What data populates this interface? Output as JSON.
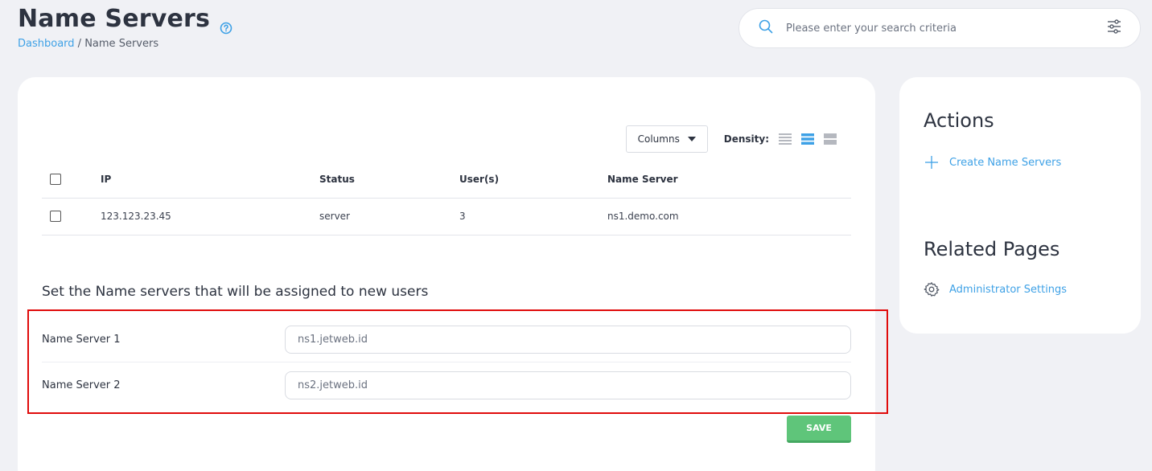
{
  "header": {
    "title": "Name Servers",
    "breadcrumb_root": "Dashboard",
    "breadcrumb_sep": "/",
    "breadcrumb_current": "Name Servers"
  },
  "search": {
    "placeholder": "Please enter your search criteria"
  },
  "toolbar": {
    "columns_label": "Columns",
    "density_label": "Density:"
  },
  "table": {
    "headers": [
      "IP",
      "Status",
      "User(s)",
      "Name Server"
    ],
    "rows": [
      [
        "123.123.23.45",
        "server",
        "3",
        "ns1.demo.com"
      ]
    ]
  },
  "nameservers": {
    "heading": "Set the Name servers that will be assigned to new users",
    "ns1_label": "Name Server 1",
    "ns1_value": "ns1.jetweb.id",
    "ns2_label": "Name Server 2",
    "ns2_value": "ns2.jetweb.id",
    "save_label": "SAVE"
  },
  "sidebar": {
    "actions_heading": "Actions",
    "create_label": "Create Name Servers",
    "related_heading": "Related Pages",
    "admin_label": "Administrator Settings"
  },
  "colors": {
    "accent": "#3ea1e6",
    "save": "#5fc57a",
    "highlight": "#e00b0b"
  }
}
